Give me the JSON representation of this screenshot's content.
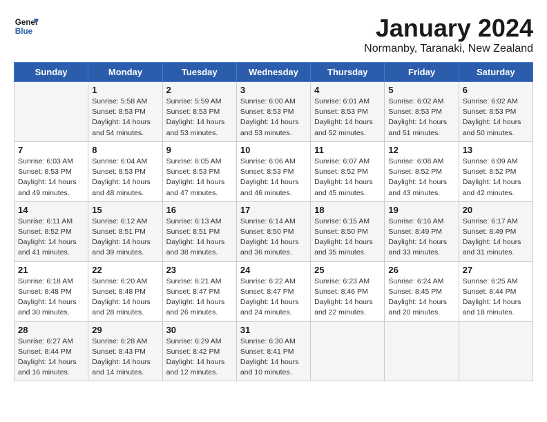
{
  "header": {
    "logo_line1": "General",
    "logo_line2": "Blue",
    "title": "January 2024",
    "subtitle": "Normanby, Taranaki, New Zealand"
  },
  "days_of_week": [
    "Sunday",
    "Monday",
    "Tuesday",
    "Wednesday",
    "Thursday",
    "Friday",
    "Saturday"
  ],
  "weeks": [
    [
      {
        "day": "",
        "info": ""
      },
      {
        "day": "1",
        "info": "Sunrise: 5:58 AM\nSunset: 8:53 PM\nDaylight: 14 hours\nand 54 minutes."
      },
      {
        "day": "2",
        "info": "Sunrise: 5:59 AM\nSunset: 8:53 PM\nDaylight: 14 hours\nand 53 minutes."
      },
      {
        "day": "3",
        "info": "Sunrise: 6:00 AM\nSunset: 8:53 PM\nDaylight: 14 hours\nand 53 minutes."
      },
      {
        "day": "4",
        "info": "Sunrise: 6:01 AM\nSunset: 8:53 PM\nDaylight: 14 hours\nand 52 minutes."
      },
      {
        "day": "5",
        "info": "Sunrise: 6:02 AM\nSunset: 8:53 PM\nDaylight: 14 hours\nand 51 minutes."
      },
      {
        "day": "6",
        "info": "Sunrise: 6:02 AM\nSunset: 8:53 PM\nDaylight: 14 hours\nand 50 minutes."
      }
    ],
    [
      {
        "day": "7",
        "info": "Sunrise: 6:03 AM\nSunset: 8:53 PM\nDaylight: 14 hours\nand 49 minutes."
      },
      {
        "day": "8",
        "info": "Sunrise: 6:04 AM\nSunset: 8:53 PM\nDaylight: 14 hours\nand 48 minutes."
      },
      {
        "day": "9",
        "info": "Sunrise: 6:05 AM\nSunset: 8:53 PM\nDaylight: 14 hours\nand 47 minutes."
      },
      {
        "day": "10",
        "info": "Sunrise: 6:06 AM\nSunset: 8:53 PM\nDaylight: 14 hours\nand 46 minutes."
      },
      {
        "day": "11",
        "info": "Sunrise: 6:07 AM\nSunset: 8:52 PM\nDaylight: 14 hours\nand 45 minutes."
      },
      {
        "day": "12",
        "info": "Sunrise: 6:08 AM\nSunset: 8:52 PM\nDaylight: 14 hours\nand 43 minutes."
      },
      {
        "day": "13",
        "info": "Sunrise: 6:09 AM\nSunset: 8:52 PM\nDaylight: 14 hours\nand 42 minutes."
      }
    ],
    [
      {
        "day": "14",
        "info": "Sunrise: 6:11 AM\nSunset: 8:52 PM\nDaylight: 14 hours\nand 41 minutes."
      },
      {
        "day": "15",
        "info": "Sunrise: 6:12 AM\nSunset: 8:51 PM\nDaylight: 14 hours\nand 39 minutes."
      },
      {
        "day": "16",
        "info": "Sunrise: 6:13 AM\nSunset: 8:51 PM\nDaylight: 14 hours\nand 38 minutes."
      },
      {
        "day": "17",
        "info": "Sunrise: 6:14 AM\nSunset: 8:50 PM\nDaylight: 14 hours\nand 36 minutes."
      },
      {
        "day": "18",
        "info": "Sunrise: 6:15 AM\nSunset: 8:50 PM\nDaylight: 14 hours\nand 35 minutes."
      },
      {
        "day": "19",
        "info": "Sunrise: 6:16 AM\nSunset: 8:49 PM\nDaylight: 14 hours\nand 33 minutes."
      },
      {
        "day": "20",
        "info": "Sunrise: 6:17 AM\nSunset: 8:49 PM\nDaylight: 14 hours\nand 31 minutes."
      }
    ],
    [
      {
        "day": "21",
        "info": "Sunrise: 6:18 AM\nSunset: 8:48 PM\nDaylight: 14 hours\nand 30 minutes."
      },
      {
        "day": "22",
        "info": "Sunrise: 6:20 AM\nSunset: 8:48 PM\nDaylight: 14 hours\nand 28 minutes."
      },
      {
        "day": "23",
        "info": "Sunrise: 6:21 AM\nSunset: 8:47 PM\nDaylight: 14 hours\nand 26 minutes."
      },
      {
        "day": "24",
        "info": "Sunrise: 6:22 AM\nSunset: 8:47 PM\nDaylight: 14 hours\nand 24 minutes."
      },
      {
        "day": "25",
        "info": "Sunrise: 6:23 AM\nSunset: 8:46 PM\nDaylight: 14 hours\nand 22 minutes."
      },
      {
        "day": "26",
        "info": "Sunrise: 6:24 AM\nSunset: 8:45 PM\nDaylight: 14 hours\nand 20 minutes."
      },
      {
        "day": "27",
        "info": "Sunrise: 6:25 AM\nSunset: 8:44 PM\nDaylight: 14 hours\nand 18 minutes."
      }
    ],
    [
      {
        "day": "28",
        "info": "Sunrise: 6:27 AM\nSunset: 8:44 PM\nDaylight: 14 hours\nand 16 minutes."
      },
      {
        "day": "29",
        "info": "Sunrise: 6:28 AM\nSunset: 8:43 PM\nDaylight: 14 hours\nand 14 minutes."
      },
      {
        "day": "30",
        "info": "Sunrise: 6:29 AM\nSunset: 8:42 PM\nDaylight: 14 hours\nand 12 minutes."
      },
      {
        "day": "31",
        "info": "Sunrise: 6:30 AM\nSunset: 8:41 PM\nDaylight: 14 hours\nand 10 minutes."
      },
      {
        "day": "",
        "info": ""
      },
      {
        "day": "",
        "info": ""
      },
      {
        "day": "",
        "info": ""
      }
    ]
  ]
}
